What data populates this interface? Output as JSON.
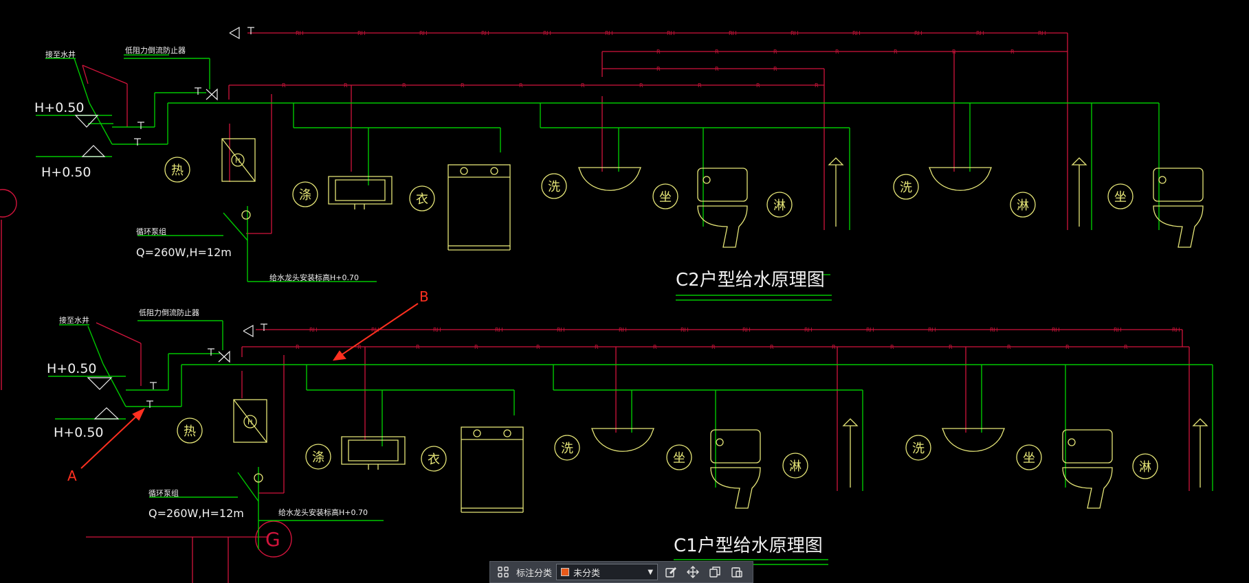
{
  "drawing": {
    "upper": {
      "title": "C2户型给水原理图",
      "label_well": "接至水井",
      "label_backflow": "低阻力倒流防止器",
      "elevation_1": "H+0.50",
      "elevation_2": "H+0.50",
      "pump_label": "循环泵组",
      "pump_spec": "Q=260W,H=12m",
      "faucet_note": "给水龙头安装标高H+0.70",
      "fixture_hot": "热",
      "fixture_basin": "涤",
      "fixture_laundry": "衣",
      "fixture_wash_1": "洗",
      "fixture_toilet_1": "坐",
      "fixture_shower_1": "淋",
      "fixture_wash_2": "洗",
      "fixture_shower_2": "淋",
      "fixture_toilet_2": "坐",
      "heater_symbol": "H"
    },
    "lower": {
      "title": "C1户型给水原理图",
      "label_well": "接至水井",
      "label_backflow": "低阻力倒流防止器",
      "elevation_1": "H+0.50",
      "elevation_2": "H+0.50",
      "pump_label": "循环泵组",
      "pump_spec": "Q=260W,H=12m",
      "faucet_note": "给水龙头安装标高H+0.70",
      "fixture_hot": "热",
      "fixture_basin": "涤",
      "fixture_laundry": "衣",
      "fixture_wash_1": "洗",
      "fixture_toilet_1": "坐",
      "fixture_shower_1": "淋",
      "fixture_wash_2": "洗",
      "fixture_toilet_2": "坐",
      "fixture_shower_2": "淋",
      "heater_symbol": "H",
      "circle_g": "G"
    },
    "annotations": {
      "a": "A",
      "b": "B"
    },
    "pipe_label_hot": "RH",
    "pipe_label_return": "R"
  },
  "toolbar": {
    "category_label": "标注分类",
    "selected_value": "未分类",
    "swatch_color": "#e85a1b",
    "icons": [
      "grid-icon",
      "edit-icon",
      "move-icon",
      "copy-icon",
      "paste-icon"
    ]
  },
  "colors": {
    "background": "#000000",
    "cold_pipe": "#00c800",
    "hot_pipe": "#d2143c",
    "fixture": "#e6e678",
    "text": "#f0f0f0",
    "annotation": "#ff3020"
  }
}
